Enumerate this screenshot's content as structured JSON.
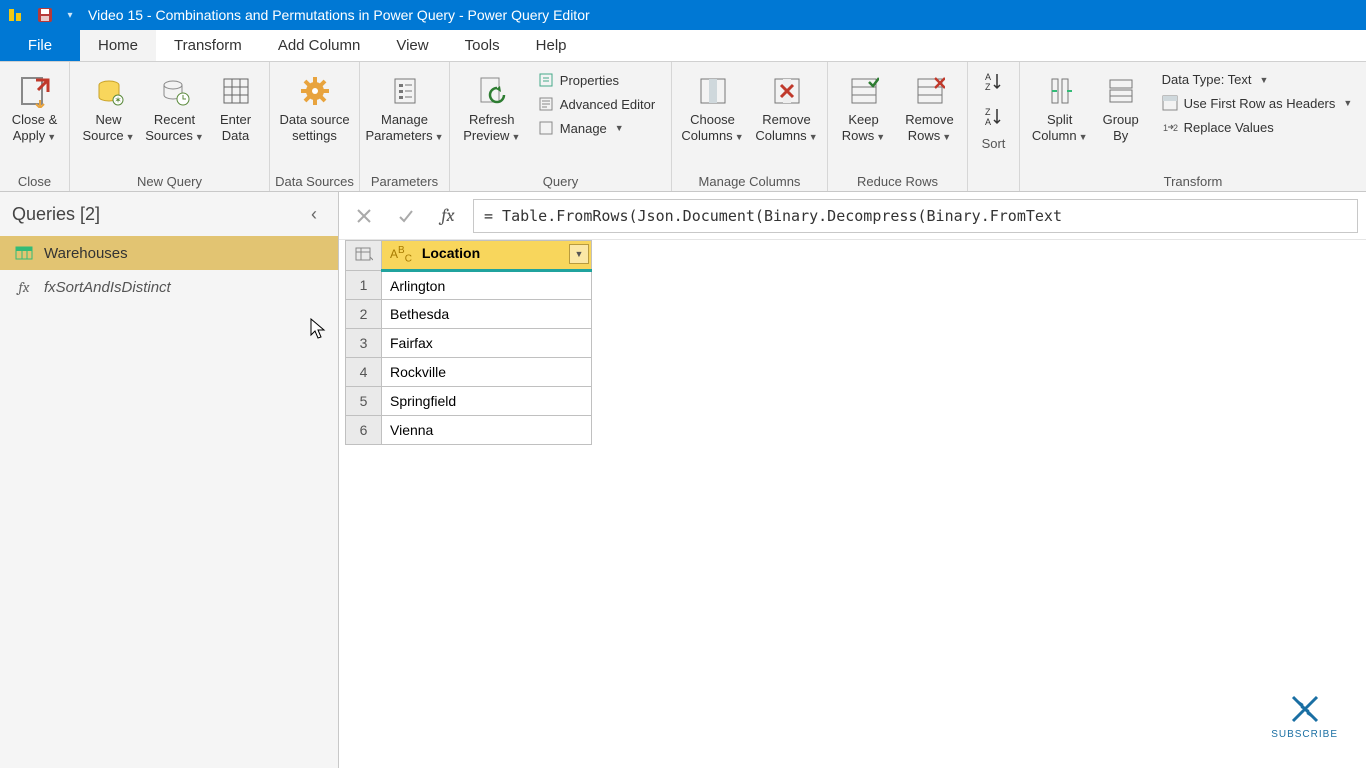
{
  "title": "Video 15 - Combinations and Permutations in Power Query - Power Query Editor",
  "tabs": {
    "file": "File",
    "home": "Home",
    "transform": "Transform",
    "addcol": "Add Column",
    "view": "View",
    "tools": "Tools",
    "help": "Help"
  },
  "ribbon": {
    "close": {
      "label": "Close &\nApply",
      "group": "Close"
    },
    "newquery": {
      "newsource": "New\nSource",
      "recent": "Recent\nSources",
      "enter": "Enter\nData",
      "group": "New Query"
    },
    "datasources": {
      "settings": "Data source\nsettings",
      "group": "Data Sources"
    },
    "parameters": {
      "manage": "Manage\nParameters",
      "group": "Parameters"
    },
    "query": {
      "refresh": "Refresh\nPreview",
      "properties": "Properties",
      "adv": "Advanced Editor",
      "manage": "Manage",
      "group": "Query"
    },
    "managecols": {
      "choose": "Choose\nColumns",
      "remove": "Remove\nColumns",
      "group": "Manage Columns"
    },
    "reducerows": {
      "keep": "Keep\nRows",
      "remove": "Remove\nRows",
      "group": "Reduce Rows"
    },
    "sort": {
      "group": "Sort"
    },
    "transform": {
      "split": "Split\nColumn",
      "groupby": "Group\nBy",
      "datatype": "Data Type: Text",
      "firstrow": "Use First Row as Headers",
      "replace": "Replace Values",
      "group": "Transform"
    }
  },
  "queries": {
    "header": "Queries [2]",
    "items": [
      {
        "name": "Warehouses",
        "kind": "table",
        "selected": true
      },
      {
        "name": "fxSortAndIsDistinct",
        "kind": "function",
        "selected": false
      }
    ]
  },
  "formula": "= Table.FromRows(Json.Document(Binary.Decompress(Binary.FromText",
  "grid": {
    "column": "Location",
    "rows": [
      "Arlington",
      "Bethesda",
      "Fairfax",
      "Rockville",
      "Springfield",
      "Vienna"
    ]
  },
  "subscribe": "SUBSCRIBE"
}
